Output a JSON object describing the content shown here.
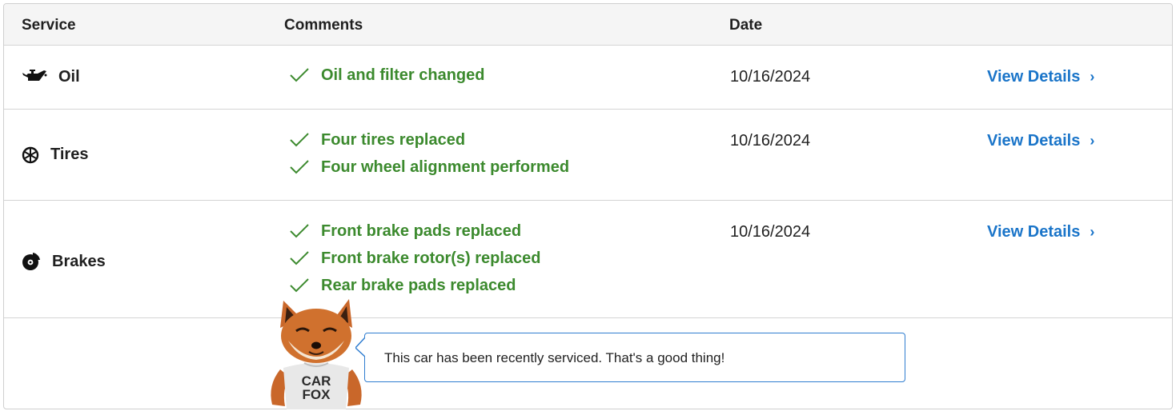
{
  "header": {
    "service": "Service",
    "comments": "Comments",
    "date": "Date"
  },
  "rows": [
    {
      "service": "Oil",
      "icon": "oil-can-icon",
      "comments": [
        "Oil and filter changed"
      ],
      "date": "10/16/2024",
      "link": "View Details"
    },
    {
      "service": "Tires",
      "icon": "tire-icon",
      "comments": [
        "Four tires replaced",
        "Four wheel alignment performed"
      ],
      "date": "10/16/2024",
      "link": "View Details"
    },
    {
      "service": "Brakes",
      "icon": "brake-disc-icon",
      "comments": [
        "Front brake pads replaced",
        "Front brake rotor(s) replaced",
        "Rear brake pads replaced"
      ],
      "date": "10/16/2024",
      "link": "View Details"
    }
  ],
  "footer": {
    "message": "This car has been recently serviced. That's a good thing!",
    "shirt_line1": "CAR",
    "shirt_line2": "FOX"
  },
  "colors": {
    "comment_green": "#3c8a2e",
    "link_blue": "#1b75c9",
    "bubble_border": "#2f7dd0"
  }
}
